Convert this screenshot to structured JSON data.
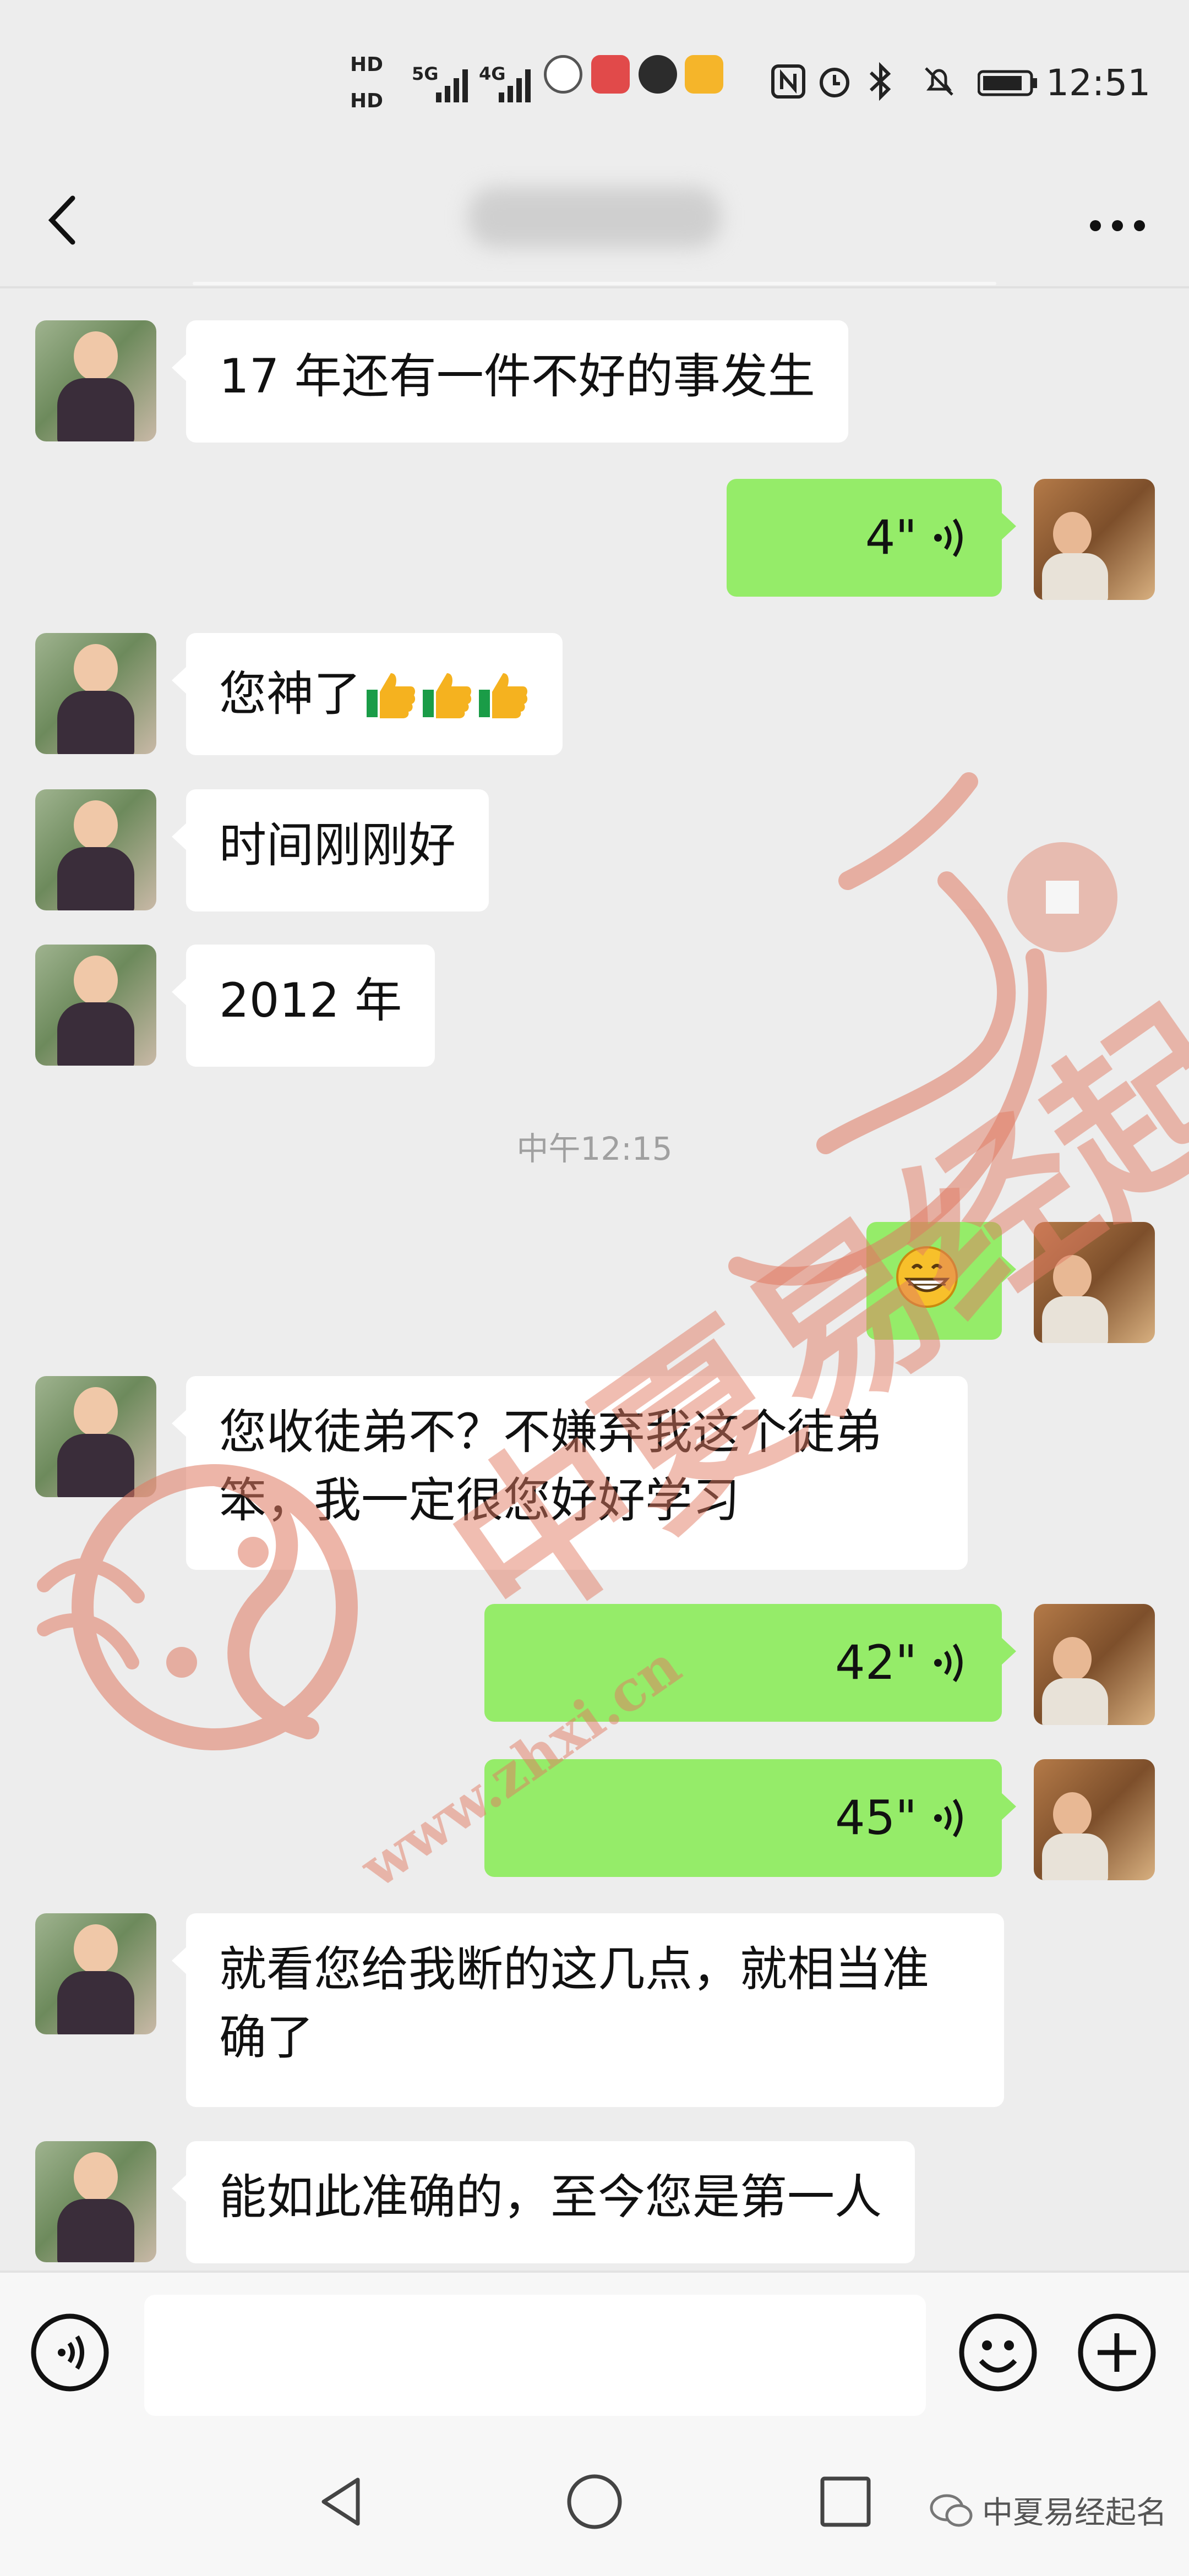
{
  "status_bar": {
    "time": "12:51",
    "hd1": "HD",
    "hd2": "HD",
    "net1": "5G",
    "net2": "4G"
  },
  "header": {
    "title": "",
    "back_icon": "back-arrow-icon",
    "more_icon": "more-dots-icon"
  },
  "messages": [
    {
      "side": "in",
      "type": "text",
      "text": "17 年还有一件不好的事发生"
    },
    {
      "side": "out",
      "type": "voice",
      "duration": "4\""
    },
    {
      "side": "in",
      "type": "text",
      "text": "您神了",
      "emoji": [
        "thumbs-up",
        "thumbs-up",
        "thumbs-up"
      ]
    },
    {
      "side": "in",
      "type": "text",
      "text": "时间刚刚好"
    },
    {
      "side": "in",
      "type": "text",
      "text": "2012 年"
    },
    {
      "type": "timestamp",
      "text": "中午12:15"
    },
    {
      "side": "out",
      "type": "emoji",
      "emoji": "grinning-face"
    },
    {
      "side": "in",
      "type": "text",
      "text_lines": [
        "您收徒弟不？不嫌弃我这个徒弟",
        "笨，我一定很您好好学习"
      ]
    },
    {
      "side": "out",
      "type": "voice",
      "duration": "42\""
    },
    {
      "side": "out",
      "type": "voice",
      "duration": "45\""
    },
    {
      "side": "in",
      "type": "text",
      "text_lines": [
        "就看您给我断的这几点，就相当准",
        "确了"
      ]
    },
    {
      "side": "in",
      "type": "text",
      "text": "能如此准确的，至今您是第一人"
    }
  ],
  "input_bar": {
    "voice_icon": "voice-input-icon",
    "emoji_icon": "emoji-icon",
    "plus_icon": "plus-icon"
  },
  "nav_bar": {
    "back_icon": "nav-back-icon",
    "home_icon": "nav-home-icon",
    "recent_icon": "nav-recent-icon"
  },
  "watermark": {
    "brand_text": "中夏易经起名",
    "url_text": "www.zhxi.cn",
    "logo_text": "中夏易经起名"
  },
  "colors": {
    "bg": "#ededed",
    "bubble_out": "#95ec69",
    "bubble_in": "#ffffff",
    "watermark": "#e07a62"
  }
}
